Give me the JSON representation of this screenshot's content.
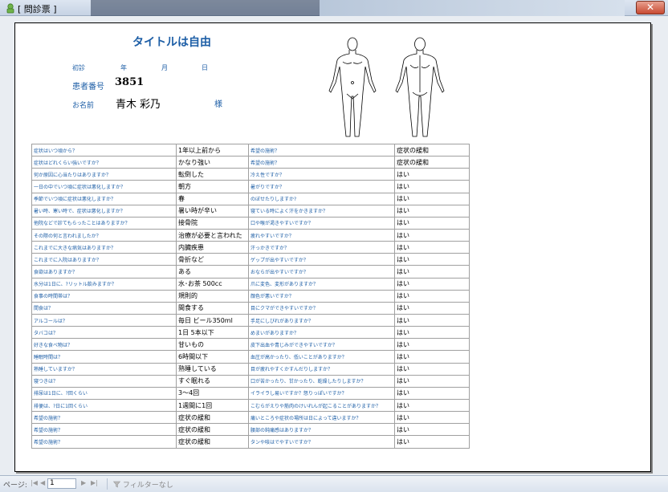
{
  "window": {
    "title": "[ 問診票 ]",
    "close_label": "✕"
  },
  "document": {
    "title": "タイトルは自由",
    "date_labels": [
      "初診",
      "年",
      "月",
      "日"
    ],
    "patient_label": "患者番号",
    "patient_number": "3851",
    "name_label": "お名前",
    "name_value": "青木 彩乃",
    "honorific": "様"
  },
  "table": {
    "rows": [
      [
        "症状はいつ頃から？",
        "1年以上前から",
        "希望の施術？",
        "症状の緩和"
      ],
      [
        "症状はどれくらい強いですか？",
        "かなり強い",
        "希望の施術？",
        "症状の緩和"
      ],
      [
        "何か原因に心当たりはありますか？",
        "転倒した",
        "冷え性ですか？",
        "はい"
      ],
      [
        "一日の中でいつ頃に症状は悪化しますか？",
        "朝方",
        "暑がりですか？",
        "はい"
      ],
      [
        "季節でいつ頃に症状は悪化しますか？",
        "春",
        "のぼせたりしますか?",
        "はい"
      ],
      [
        "暑い時、寒い時で、症状は悪化しますか？",
        "暑い時が辛い",
        "寝ている時によく汗をかきますか？",
        "はい"
      ],
      [
        "他院などで診てもらったことはありますか？",
        "接骨院",
        "口や喉が渇きやすいですか？",
        "はい"
      ],
      [
        "その際の何と言われましたか？",
        "治療が必要と言われた",
        "疲れやすいですか？",
        "はい"
      ],
      [
        "これまでに大きな病気はありますか？",
        "内臓疾患",
        "汗っかきですか？",
        "はい"
      ],
      [
        "これまでに入院はありますか？",
        "骨折など",
        "ゲップが出やすいですか？",
        "はい"
      ],
      [
        "食欲はありますか？",
        "ある",
        "おならが出やすいですか？",
        "はい"
      ],
      [
        "水分は1日に、?リットル飲みますか？",
        "水･お茶 500cc",
        "爪に変色、変形がありますか？",
        "はい"
      ],
      [
        "食事の時間帯は？",
        "規則的",
        "顔色が悪いですか？",
        "はい"
      ],
      [
        "間食は？",
        "間食する",
        "目にクマができやすいですか？",
        "はい"
      ],
      [
        "アルコールは？",
        "毎日 ビール350ml",
        "手足にしびれがありますか？",
        "はい"
      ],
      [
        "タバコは？",
        "1日 5本以下",
        "めまいがありますか？",
        "はい"
      ],
      [
        "好きな食べ物は？",
        "甘いもの",
        "皮下出血や青じみができやすいですか？",
        "はい"
      ],
      [
        "睡眠時間は？",
        "6時間以下",
        "血圧が高かったり、低いことがありますか？",
        "はい"
      ],
      [
        "熟睡していますか？",
        "熟睡している",
        "目が疲れやすくかすんだりしますか？",
        "はい"
      ],
      [
        "寝つきは？",
        "すぐ眠れる",
        "口が苦かったり、甘かったり、乾燥したりしますか？",
        "はい"
      ],
      [
        "排尿は1日に、?回くらい",
        "3〜4回",
        "イライラし易いですか？怒りっぽいですか？",
        "はい"
      ],
      [
        "排便は、?日に1回くらい",
        "1週間に1回",
        "こむらがえりや筋肉のけいれんが起こることがありますか？",
        "はい"
      ],
      [
        "希望の施術？",
        "症状の緩和",
        "痛いところや症状の場所は日によって違いますか？",
        "はい"
      ],
      [
        "希望の施術？",
        "症状の緩和",
        "腰部の鈍痛感はありますか？",
        "はい"
      ],
      [
        "希望の施術？",
        "症状の緩和",
        "タンや咳はでやすいですか？",
        "はい"
      ]
    ]
  },
  "statusbar": {
    "page_label": "ページ:",
    "nav_first": "|◀",
    "nav_prev": "◀",
    "page_value": "1",
    "nav_next": "▶",
    "nav_last": "▶|",
    "filter_label": "フィルターなし",
    "filter_icon": "funnel-icon"
  },
  "colors": {
    "accent": "#1d5ea6",
    "frame": "#e9edf2",
    "titlebar": "#c6d3e4"
  }
}
